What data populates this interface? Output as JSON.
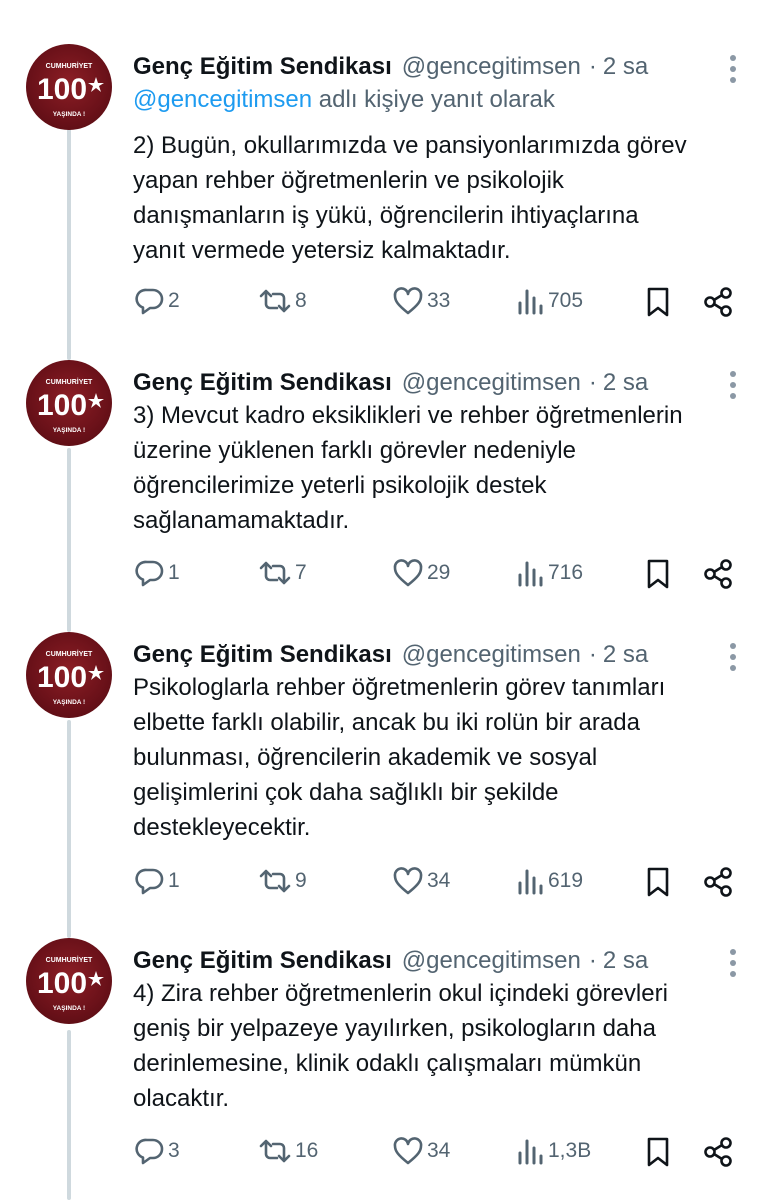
{
  "tweets": [
    {
      "author_name": "Genç Eğitim Sendikası",
      "handle": "@gencegitimsen",
      "time": "2 sa",
      "reply_to_mention": "@gencegitimsen",
      "reply_to_suffix": " adlı kişiye yanıt olarak",
      "text": "2) Bugün, okullarımızda ve pansiyonlarımızda görev\nyapan rehber öğretmenlerin ve psikolojik\ndanışmanların iş yükü, öğrencilerin ihtiyaçlarına\nyanıt vermede yetersiz kalmaktadır.",
      "replies": "2",
      "reposts": "8",
      "likes": "33",
      "views": "705"
    },
    {
      "author_name": "Genç Eğitim Sendikası",
      "handle": "@gencegitimsen",
      "time": "2 sa",
      "text": "3) Mevcut kadro eksiklikleri ve rehber öğretmenlerin\nüzerine yüklenen farklı görevler nedeniyle\nöğrencilerimize yeterli psikolojik destek\nsağlanamamaktadır.",
      "replies": "1",
      "reposts": "7",
      "likes": "29",
      "views": "716"
    },
    {
      "author_name": "Genç Eğitim Sendikası",
      "handle": "@gencegitimsen",
      "time": "2 sa",
      "text": "Psikologlarla rehber öğretmenlerin görev tanımları\nelbette farklı olabilir, ancak bu iki rolün bir arada\nbulunması, öğrencilerin akademik ve sosyal\ngelişimlerini çok daha sağlıklı bir şekilde\ndestekleyecektir.",
      "replies": "1",
      "reposts": "9",
      "likes": "34",
      "views": "619"
    },
    {
      "author_name": "Genç Eğitim Sendikası",
      "handle": "@gencegitimsen",
      "time": "2 sa",
      "text": "4) Zira rehber öğretmenlerin okul içindeki görevleri\ngeniş bir yelpazeye yayılırken, psikologların daha\nderinlemesine, klinik odaklı çalışmaları mümkün\nolacaktır.",
      "replies": "3",
      "reposts": "16",
      "likes": "34",
      "views": "1,3B"
    }
  ],
  "avatar": {
    "top_text": "CUMHURİYET",
    "number": "100",
    "bottom_text": "YAŞINDA !",
    "bg_color": "#6a1119",
    "fg_color": "#ffffff"
  },
  "colors": {
    "text": "#0f1419",
    "secondary": "#536471",
    "link": "#1d9bf0",
    "thread_line": "#cfd9de"
  },
  "icons": [
    "more-icon",
    "reply-icon",
    "repost-icon",
    "like-icon",
    "views-icon",
    "bookmark-icon",
    "share-icon"
  ]
}
